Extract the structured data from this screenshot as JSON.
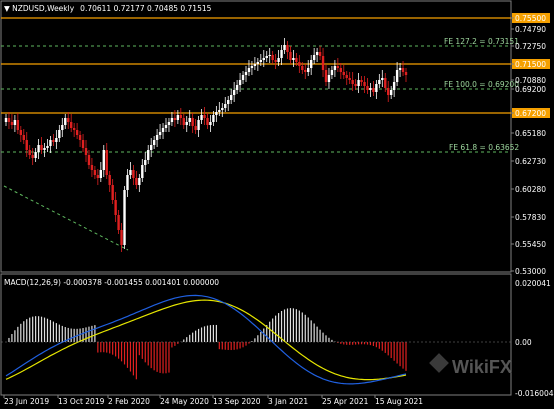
{
  "header": {
    "symbol_label": "NZDUSD,Weekly",
    "ohlc": "0.70611 0.72177 0.70485 0.71515"
  },
  "fib_labels": {
    "fe127": "FE 127.2 = 0.73151",
    "fe100": "FE 100.0 = 0.69200",
    "fe618": "FE 61.8 = 0.63652"
  },
  "price_axis": {
    "ticks": [
      "0.75500",
      "0.74790",
      "0.72750",
      "0.71500",
      "0.70880",
      "0.69200",
      "0.67200",
      "0.65180",
      "0.62730",
      "0.60280",
      "0.57830",
      "0.55450",
      "0.53000"
    ],
    "highlight": [
      "0.75500",
      "0.71500",
      "0.67200"
    ],
    "highlight_color": "#f5a000",
    "current_color": "#c8c8c8"
  },
  "macd": {
    "label": "MACD(12,26,9) -0.000378 -0.001455 0.001401 0.000000",
    "axis_ticks": [
      "0.020041",
      "0.00",
      "-0.016004"
    ]
  },
  "time_axis": {
    "labels": [
      "23 Jun 2019",
      "13 Oct 2019",
      "2 Feb 2020",
      "24 May 2020",
      "13 Sep 2020",
      "3 Jan 2021",
      "25 Apr 2021",
      "15 Aug 2021"
    ]
  },
  "watermark": {
    "text": "WikiFX"
  },
  "colors": {
    "bull": "#ffffff",
    "bear": "#e02020",
    "level_orange": "#f5a000",
    "fib_green": "#5fb85f",
    "macd_signal": "#e6e600",
    "macd_line": "#2060e0",
    "grid": "#808080"
  }
}
